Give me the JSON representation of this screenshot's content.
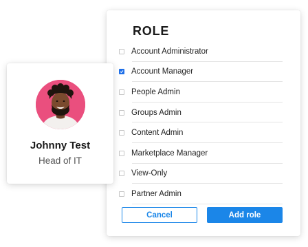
{
  "role_panel": {
    "title": "ROLE",
    "roles": [
      {
        "label": "Account Administrator",
        "checked": false
      },
      {
        "label": "Account Manager",
        "checked": true
      },
      {
        "label": "People Admin",
        "checked": false
      },
      {
        "label": "Groups Admin",
        "checked": false
      },
      {
        "label": "Content Admin",
        "checked": false
      },
      {
        "label": "Marketplace Manager",
        "checked": false
      },
      {
        "label": "View-Only",
        "checked": false
      },
      {
        "label": "Partner Admin",
        "checked": false
      }
    ],
    "cancel_label": "Cancel",
    "add_label": "Add role"
  },
  "profile": {
    "name": "Johnny Test",
    "title": "Head of IT",
    "avatar_bg_color": "#ea4f7e"
  },
  "colors": {
    "accent": "#1b86e8",
    "checkbox_checked": "#1e6fe8"
  }
}
